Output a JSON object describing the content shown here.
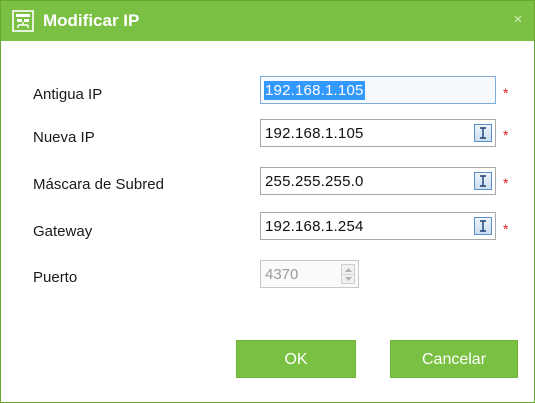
{
  "dialog": {
    "title": "Modificar IP",
    "close_symbol": "×",
    "icon": "network-settings-icon"
  },
  "fields": {
    "old_ip": {
      "label": "Antigua IP",
      "value": "192.168.1.105",
      "selected": true,
      "required": "*"
    },
    "new_ip": {
      "label": "Nueva IP",
      "value": "192.168.1.105",
      "required": "*"
    },
    "subnet_mask": {
      "label": "Máscara de Subred",
      "value": "255.255.255.0",
      "required": "*"
    },
    "gateway": {
      "label": "Gateway",
      "value": "192.168.1.254",
      "required": "*"
    },
    "port": {
      "label": "Puerto",
      "value": "4370",
      "disabled": true
    }
  },
  "buttons": {
    "ok_label": "OK",
    "cancel_label": "Cancelar"
  },
  "colors": {
    "accent": "#7ac143",
    "required": "#e02020",
    "selection": "#3399ff"
  }
}
